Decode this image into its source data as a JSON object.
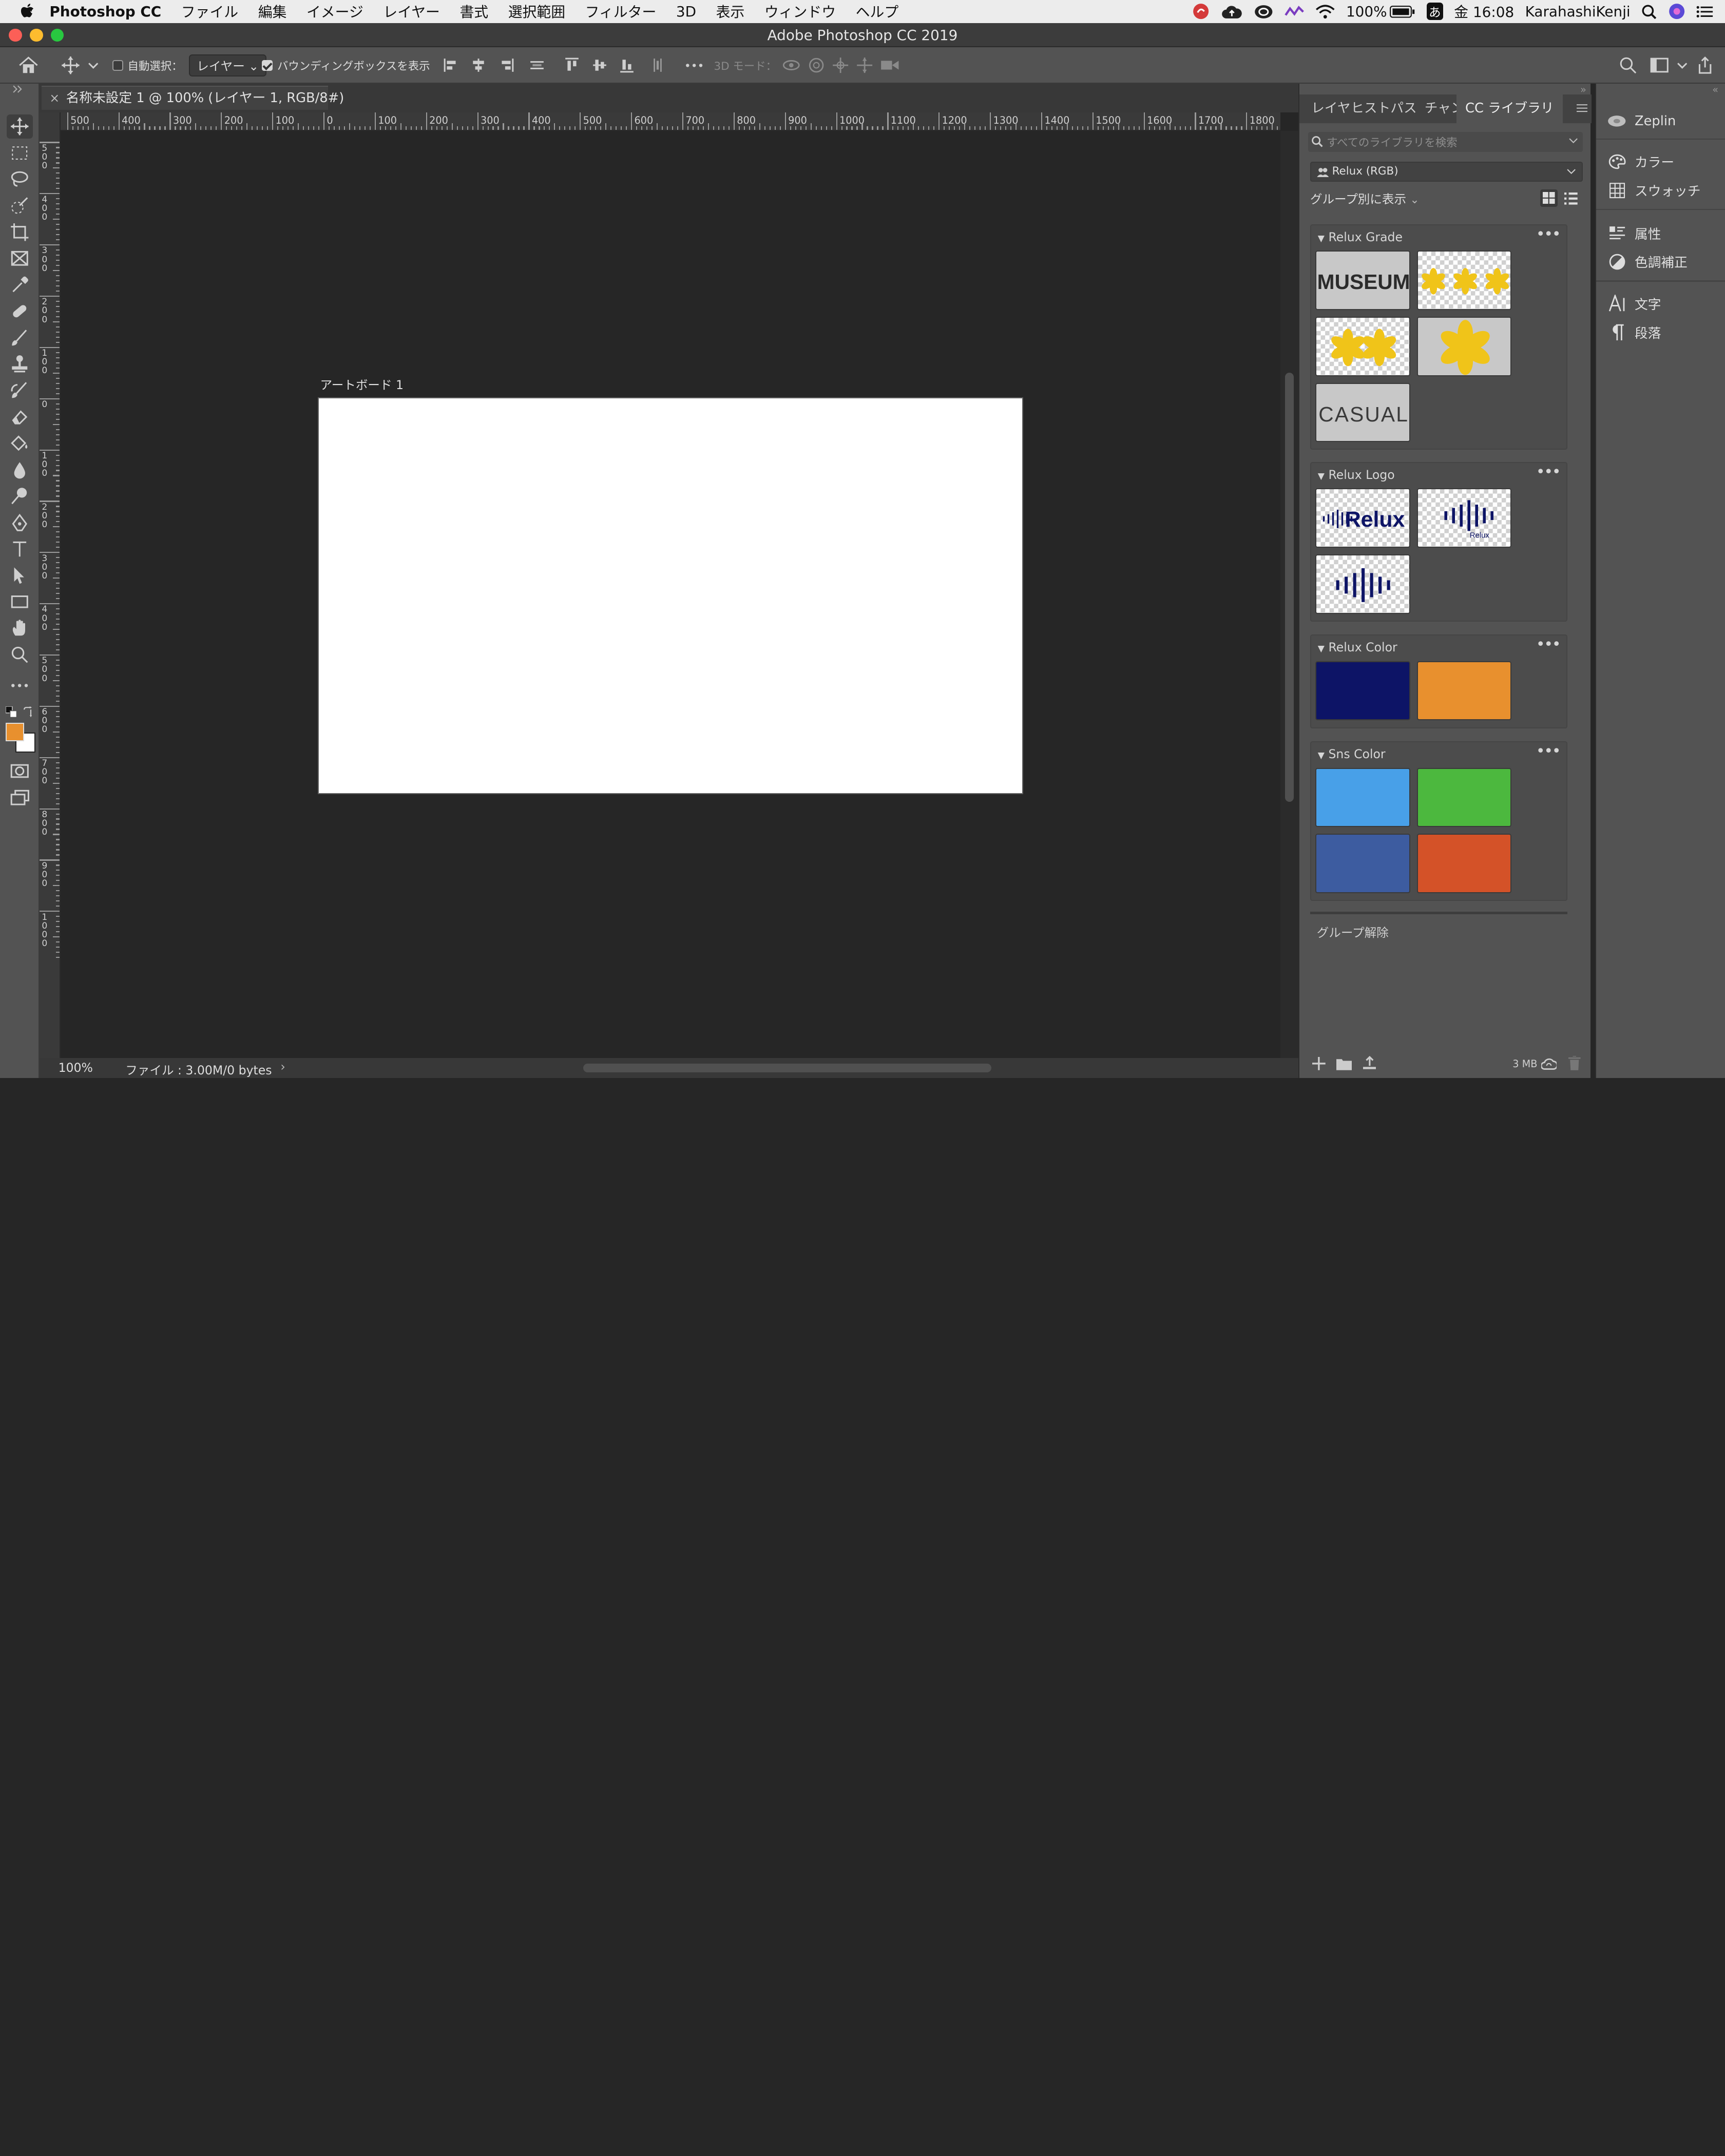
{
  "menubar": {
    "apple": "",
    "app": "Photoshop CC",
    "items": [
      "ファイル",
      "編集",
      "イメージ",
      "レイヤー",
      "書式",
      "選択範囲",
      "フィルター",
      "3D",
      "表示",
      "ウィンドウ",
      "ヘルプ"
    ],
    "battery": "100%",
    "ime": "あ",
    "clock": "金 16:08",
    "user": "KarahashiKenji"
  },
  "window": {
    "title": "Adobe Photoshop CC 2019"
  },
  "options": {
    "auto_select_label": "自動選択：",
    "auto_select_checked": false,
    "auto_select_value": "レイヤー",
    "bbox_label": "バウンディングボックスを表示",
    "bbox_checked": true,
    "mode3d_label": "3D モード："
  },
  "document": {
    "tab_title": "名称未設定 1 @ 100% (レイヤー 1, RGB/8#)",
    "artboard_label": "アートボード 1"
  },
  "ruler": {
    "h_labels": [
      "500",
      "400",
      "300",
      "200",
      "100",
      "0",
      "100",
      "200",
      "300",
      "400",
      "500",
      "600",
      "700",
      "800",
      "900",
      "1000",
      "1100",
      "1200",
      "1300",
      "1400",
      "1500",
      "1600",
      "1700",
      "1800"
    ],
    "v_labels": [
      "500",
      "400",
      "300",
      "200",
      "100",
      "0",
      "100",
      "200",
      "300",
      "400",
      "500",
      "600",
      "700",
      "800",
      "900",
      "1000"
    ]
  },
  "status": {
    "zoom": "100%",
    "file_info": "ファイル : 3.00M/0 bytes"
  },
  "panel": {
    "tabs": [
      "レイヤ",
      "ヒスト",
      "パス",
      "チャン",
      "CC ライブラリ"
    ],
    "search_placeholder": "すべてのライブラリを検索",
    "library": "Relux (RGB)",
    "group_view": "グループ別に表示",
    "groups": [
      {
        "name": "Relux Grade"
      },
      {
        "name": "Relux Logo"
      },
      {
        "name": "Relux Color",
        "colors": [
          "#0d1466",
          "#e8902e"
        ]
      },
      {
        "name": "Sns Color",
        "colors": [
          "#48a0e8",
          "#4cb83e",
          "#3d5ca0",
          "#d45228"
        ]
      }
    ],
    "thumb_text": {
      "museum": "MUSEUM",
      "casual": "CASUAL",
      "relux": "Relux"
    },
    "ungroup": "グループ解除",
    "storage": "3 MB"
  },
  "dock": {
    "items": [
      "Zeplin",
      "カラー",
      "スウォッチ",
      "属性",
      "色調補正",
      "文字",
      "段落"
    ]
  },
  "colors": {
    "foreground": "#e8902e",
    "background": "#ffffff",
    "navy": "#0d1466",
    "yellow": "#f0c419"
  }
}
